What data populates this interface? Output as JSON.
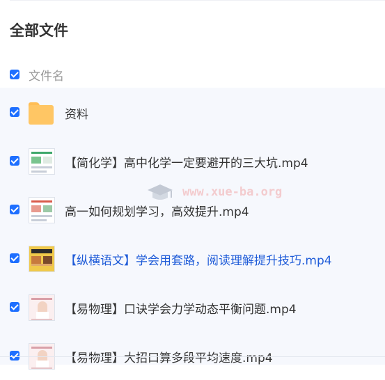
{
  "page_title": "全部文件",
  "list_header": {
    "name_column": "文件名"
  },
  "watermark": "www.xue-ba.org",
  "files": [
    {
      "name": "资料",
      "kind": "folder",
      "icon": "folder-icon"
    },
    {
      "name": "【简化学】高中化学一定要避开的三大坑.mp4",
      "kind": "video",
      "icon": "video-thumbnail"
    },
    {
      "name": "高一如何规划学习，高效提升.mp4",
      "kind": "video",
      "icon": "video-thumbnail"
    },
    {
      "name": "【纵横语文】学会用套路，阅读理解提升技巧.mp4",
      "kind": "video",
      "icon": "video-thumbnail"
    },
    {
      "name": "【易物理】口诀学会力学动态平衡问题.mp4",
      "kind": "video",
      "icon": "video-thumbnail"
    },
    {
      "name": "【易物理】大招口算多段平均速度.mp4",
      "kind": "video",
      "icon": "video-thumbnail"
    }
  ],
  "colors": {
    "accent": "#1e6fff",
    "link": "#1e5bd8",
    "folder": "#ffc664",
    "list_bg": "#f6f8fd"
  }
}
